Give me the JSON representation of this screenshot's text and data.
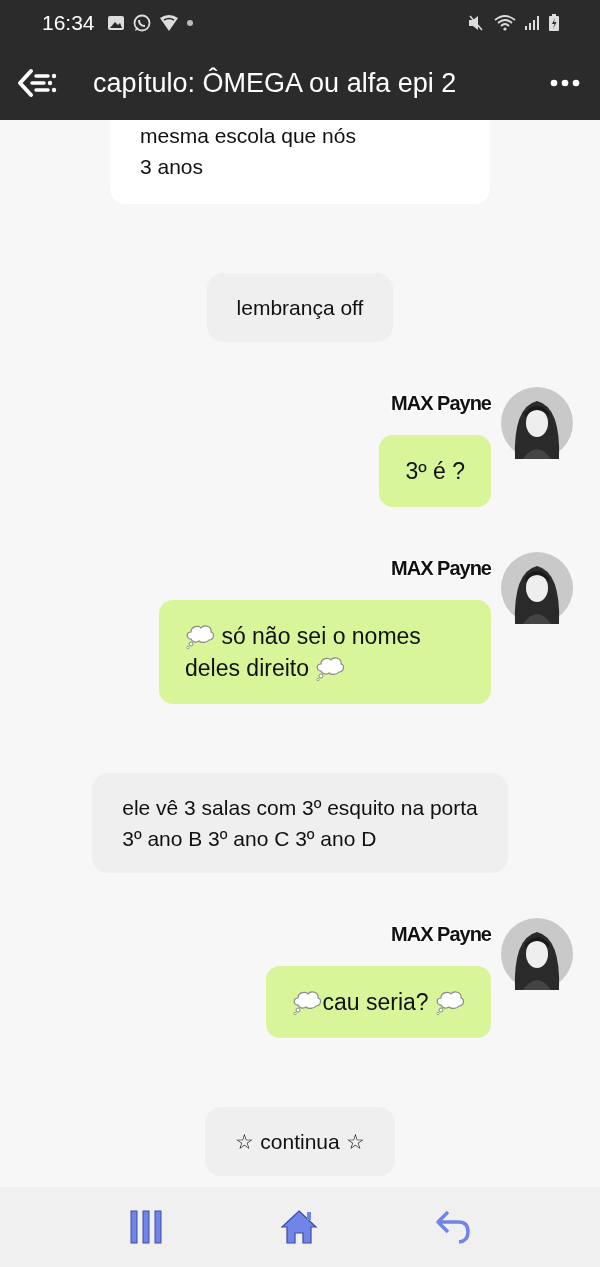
{
  "status_bar": {
    "time": "16:34"
  },
  "header": {
    "title": "capítulo: ÔMEGA ou alfa epi 2"
  },
  "messages": [
    {
      "kind": "cut_narration",
      "lines": [
        "mesma escola que nós",
        "3 anos"
      ]
    },
    {
      "kind": "narration",
      "lines": [
        "lembrança off"
      ]
    },
    {
      "kind": "character",
      "name": "MAX Payne",
      "parts": [
        {
          "kind": "text",
          "text": "3º é ?"
        }
      ]
    },
    {
      "kind": "character",
      "name": "MAX Payne",
      "parts": [
        {
          "kind": "thought"
        },
        {
          "kind": "text",
          "text": " só não sei o nomes deles direito "
        },
        {
          "kind": "thought"
        }
      ]
    },
    {
      "kind": "narration",
      "lines": [
        "ele vê 3 salas com 3º esquito na porta",
        "3º ano B 3º ano C 3º ano D"
      ]
    },
    {
      "kind": "character",
      "name": "MAX Payne",
      "parts": [
        {
          "kind": "thought"
        },
        {
          "kind": "text",
          "text": "cau seria? "
        },
        {
          "kind": "thought"
        }
      ]
    },
    {
      "kind": "narration",
      "lines": [
        "☆ continua ☆"
      ]
    }
  ]
}
